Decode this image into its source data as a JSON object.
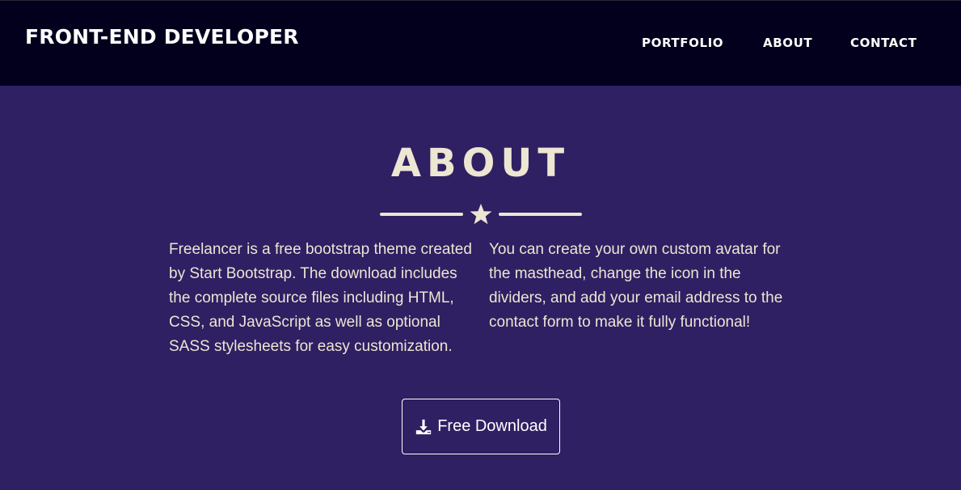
{
  "nav": {
    "brand": "FRONT-END DEVELOPER",
    "links": [
      {
        "label": "PORTFOLIO"
      },
      {
        "label": "ABOUT"
      },
      {
        "label": "CONTACT"
      }
    ]
  },
  "about": {
    "title": "ABOUT",
    "divider_icon": "star-icon",
    "paragraphs": [
      "Freelancer is a free bootstrap theme created by Start Bootstrap. The download includes the complete source files including HTML, CSS, and JavaScript as well as optional SASS stylesheets for easy customization.",
      "You can create your own custom avatar for the masthead, change the icon in the dividers, and add your email address to the contact form to make it fully functional!"
    ],
    "download_button": {
      "label": "Free Download",
      "icon": "download-icon"
    }
  },
  "colors": {
    "navbar_bg": "#02001c",
    "section_bg": "#2f1f63",
    "text": "#ece6d2",
    "button_text": "#ffffff"
  }
}
